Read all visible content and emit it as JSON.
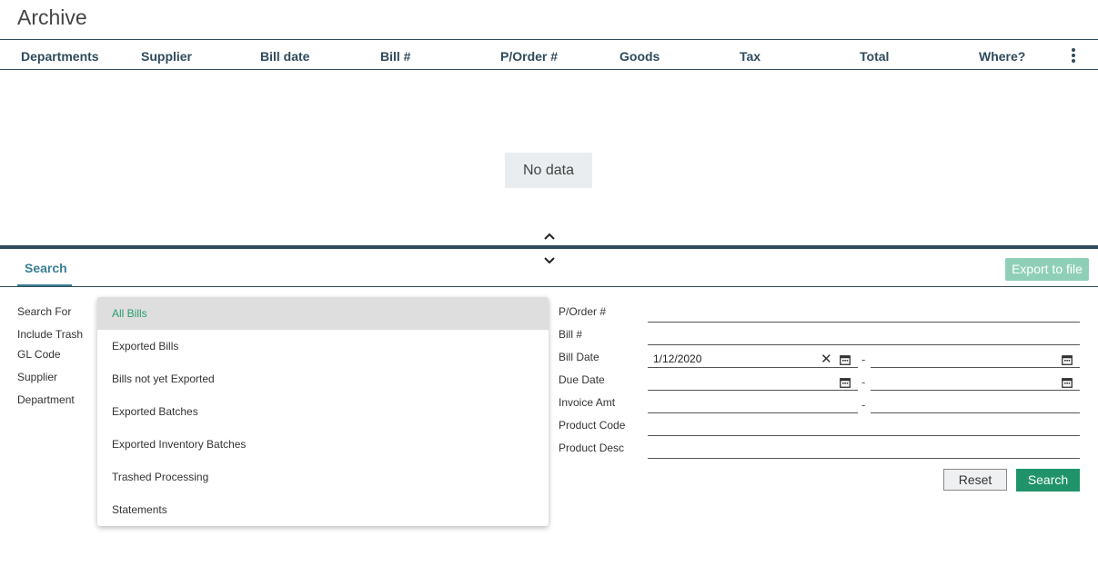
{
  "page": {
    "title": "Archive"
  },
  "grid": {
    "columns": [
      "Departments",
      "Supplier",
      "Bill date",
      "Bill #",
      "P/Order #",
      "Goods",
      "Tax",
      "Total",
      "Where?"
    ],
    "empty_text": "No data"
  },
  "panel": {
    "tab_label": "Search",
    "export_label": "Export to file"
  },
  "left_labels": {
    "search_for": "Search For",
    "include_trash": "Include Trash",
    "gl_code": "GL Code",
    "supplier": "Supplier",
    "department": "Department"
  },
  "search_for_dropdown": {
    "options": [
      "All Bills",
      "Exported Bills",
      "Bills not yet Exported",
      "Exported Batches",
      "Exported Inventory Batches",
      "Trashed Processing",
      "Statements"
    ],
    "selected": "All Bills"
  },
  "right_fields": {
    "porder_label": "P/Order #",
    "bill_label": "Bill #",
    "bill_date_label": "Bill Date",
    "bill_date_from": "1/12/2020",
    "due_date_label": "Due Date",
    "invoice_amt_label": "Invoice Amt",
    "product_code_label": "Product Code",
    "product_desc_label": "Product Desc",
    "range_sep": "-"
  },
  "actions": {
    "reset_label": "Reset",
    "search_label": "Search"
  },
  "colors": {
    "dark_teal": "#2f4b5c",
    "accent_green": "#21936a",
    "export_disabled": "#8fcfb8",
    "tab_teal": "#3a7f95"
  },
  "icons": [
    "kebab-menu-icon",
    "chevron-up-icon",
    "chevron-down-icon",
    "calendar-icon",
    "clear-icon"
  ]
}
